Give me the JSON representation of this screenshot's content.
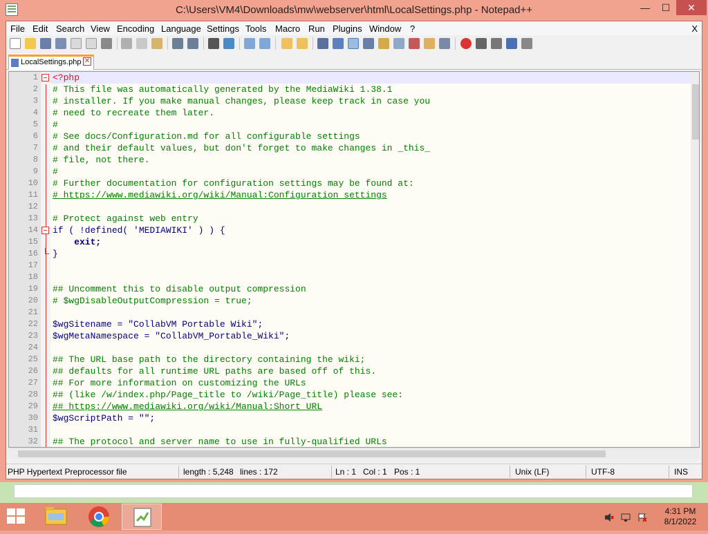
{
  "window": {
    "title": "C:\\Users\\VM4\\Downloads\\mw\\webserver\\html\\LocalSettings.php - Notepad++",
    "min_glyph": "—",
    "max_glyph": "☐",
    "close_glyph": "✕"
  },
  "menu": {
    "items": [
      "File",
      "Edit",
      "Search",
      "View",
      "Encoding",
      "Language",
      "Settings",
      "Tools",
      "Macro",
      "Run",
      "Plugins",
      "Window",
      "?"
    ],
    "close_label": "X"
  },
  "tab": {
    "label": "LocalSettings.php",
    "close_glyph": "✕"
  },
  "editor": {
    "line_numbers": [
      "1",
      "2",
      "3",
      "4",
      "5",
      "6",
      "7",
      "8",
      "9",
      "10",
      "11",
      "12",
      "13",
      "14",
      "15",
      "16",
      "17",
      "18",
      "19",
      "20",
      "21",
      "22",
      "23",
      "24",
      "25",
      "26",
      "27",
      "28",
      "29",
      "30",
      "31",
      "32"
    ],
    "lines": [
      "<?php",
      "# This file was automatically generated by the MediaWiki 1.38.1",
      "# installer. If you make manual changes, please keep track in case you",
      "# need to recreate them later.",
      "#",
      "# See docs/Configuration.md for all configurable settings",
      "# and their default values, but don't forget to make changes in _this_",
      "# file, not there.",
      "#",
      "# Further documentation for configuration settings may be found at:",
      "# https://www.mediawiki.org/wiki/Manual:Configuration_settings",
      "",
      "# Protect against web entry",
      "if ( !defined( 'MEDIAWIKI' ) ) {",
      "    exit;",
      "}",
      "",
      "",
      "## Uncomment this to disable output compression",
      "# $wgDisableOutputCompression = true;",
      "",
      "$wgSitename = \"CollabVM Portable Wiki\";",
      "$wgMetaNamespace = \"CollabVM_Portable_Wiki\";",
      "",
      "## The URL base path to the directory containing the wiki;",
      "## defaults for all runtime URL paths are based off of this.",
      "## For more information on customizing the URLs",
      "## (like /w/index.php/Page_title to /wiki/Page_title) please see:",
      "## https://www.mediawiki.org/wiki/Manual:Short_URL",
      "$wgScriptPath = \"\";",
      "",
      "## The protocol and server name to use in fully-qualified URLs"
    ]
  },
  "statusbar": {
    "filetype": "PHP Hypertext Preprocessor file",
    "length": "length : 5,248",
    "lines": "lines : 172",
    "ln": "Ln : 1",
    "col": "Col : 1",
    "pos": "Pos : 1",
    "eol": "Unix (LF)",
    "encoding": "UTF-8",
    "mode": "INS"
  },
  "taskbar": {
    "time": "4:31 PM",
    "date": "8/1/2022"
  }
}
